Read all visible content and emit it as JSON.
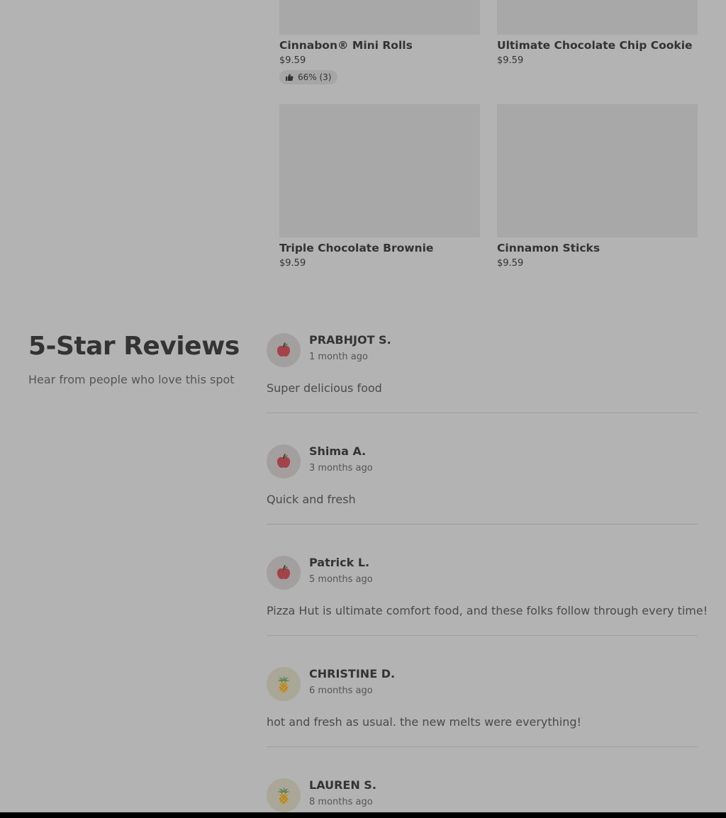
{
  "menu_items": [
    {
      "name": "Cinnabon® Mini Rolls",
      "price": "$9.59",
      "rating": "66% (3)"
    },
    {
      "name": "Ultimate Chocolate Chip Cookie",
      "price": "$9.59"
    },
    {
      "name": "Triple Chocolate Brownie",
      "price": "$9.59"
    },
    {
      "name": "Cinnamon Sticks",
      "price": "$9.59"
    }
  ],
  "reviews_section": {
    "title": "5-Star Reviews",
    "subtitle": "Hear from people who love this spot"
  },
  "reviews": [
    {
      "author": "PRABHJOT S.",
      "time": "1 month ago",
      "text": "Super delicious food",
      "avatar": "apple-icon"
    },
    {
      "author": "Shima A.",
      "time": "3 months ago",
      "text": "Quick and fresh",
      "avatar": "apple-icon"
    },
    {
      "author": "Patrick L.",
      "time": "5 months ago",
      "text": "Pizza Hut is ultimate comfort food, and these folks follow through every time!",
      "avatar": "apple-icon"
    },
    {
      "author": "CHRISTINE D.",
      "time": "6 months ago",
      "text": "hot and fresh as usual. the new melts were everything!",
      "avatar": "pineapple-icon"
    },
    {
      "author": "LAUREN S.",
      "time": "8 months ago",
      "text": "",
      "avatar": "pineapple-icon"
    }
  ]
}
